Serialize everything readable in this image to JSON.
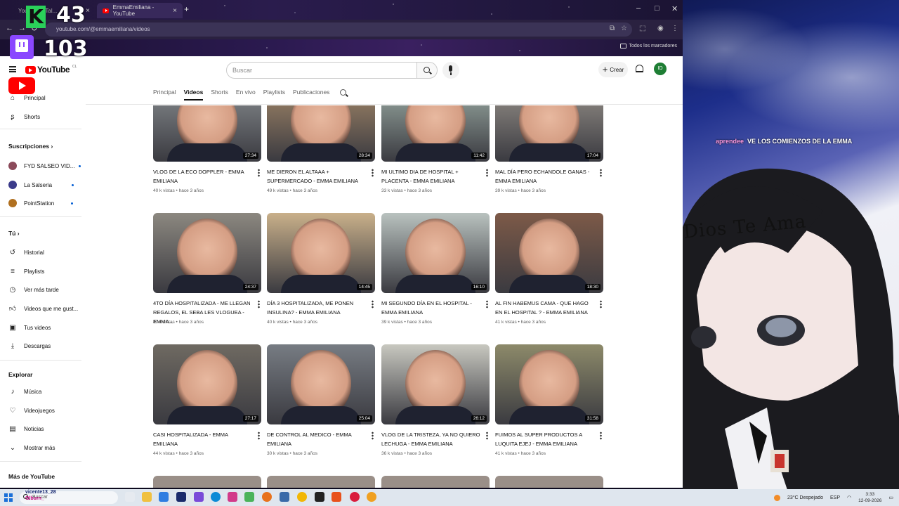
{
  "browser": {
    "tabs": [
      {
        "label": "YouTube - Tal..."
      },
      {
        "label": "EmmaEmiliana - YouTube"
      }
    ],
    "new_tab": "+",
    "window_controls": [
      "–",
      "□",
      "✕"
    ],
    "url": "youtube.com/@emmaemiliana/videos",
    "bookmarks_folder": "Todos los marcadores"
  },
  "overlays": {
    "k_badge": "K",
    "k_count": "43",
    "twitch_count": "103"
  },
  "youtube": {
    "logo": "YouTube",
    "logo_country": "CL",
    "search_placeholder": "Buscar",
    "create_label": "Crear",
    "avatar_initials": "ID",
    "sidebar": {
      "top": [
        {
          "label": "Principal",
          "icon": "home-icon"
        },
        {
          "label": "Shorts",
          "icon": "shorts-icon"
        }
      ],
      "subscriptions_heading": "Suscripciones",
      "subscriptions": [
        {
          "label": "FYD SALSEO VID...",
          "color": "#8b4a5a"
        },
        {
          "label": "La Salseria",
          "color": "#3b3b8a"
        },
        {
          "label": "PointStation",
          "color": "#b07020"
        }
      ],
      "you_heading": "Tú",
      "you_items": [
        {
          "label": "Historial",
          "icon": "history-icon"
        },
        {
          "label": "Playlists",
          "icon": "playlists-icon"
        },
        {
          "label": "Ver más tarde",
          "icon": "watch-later-icon"
        },
        {
          "label": "Videos que me gust...",
          "icon": "like-icon"
        },
        {
          "label": "Tus videos",
          "icon": "your-videos-icon"
        },
        {
          "label": "Descargas",
          "icon": "download-icon"
        }
      ],
      "explore_heading": "Explorar",
      "explore_items": [
        {
          "label": "Música",
          "icon": "music-icon"
        },
        {
          "label": "Videojuegos",
          "icon": "gaming-icon"
        },
        {
          "label": "Noticias",
          "icon": "news-icon"
        },
        {
          "label": "Mostrar más",
          "icon": "chevron-down-icon"
        }
      ],
      "more_heading": "Más de YouTube"
    },
    "channel_tabs": [
      "Principal",
      "Videos",
      "Shorts",
      "En vivo",
      "Playlists",
      "Publicaciones"
    ],
    "active_tab": "Videos",
    "videos": [
      {
        "title": "VLOG DE LA ECO DOPPLER - EMMA EMILIANA",
        "meta": "40 k vistas • hace 3 años",
        "duration": "27:34",
        "bg": "#8a8f92"
      },
      {
        "title": "ME DIERON EL ALTAAA + SUPERMERCADO - EMMA EMILIANA",
        "meta": "49 k vistas • hace 3 años",
        "duration": "28:34",
        "bg": "#a78a6a"
      },
      {
        "title": "MI ULTIMO DIA DE HOSPITAL + PLACENTA - EMMA EMILIANA",
        "meta": "33 k vistas • hace 3 años",
        "duration": "11:42",
        "bg": "#9fb0a8"
      },
      {
        "title": "MAL DÍA PERO ECHANDOLE GANAS - EMMA EMILIANA",
        "meta": "39 k vistas • hace 3 años",
        "duration": "17:04",
        "bg": "#9a948c"
      },
      {
        "title": "4TO DÍA HOSPITALIZADA - ME LLEGAN REGALOS, EL SEBA LES VLOGUEA - EMMA...",
        "meta": "47 k vistas • hace 3 años",
        "duration": "24:37",
        "bg": "#8c8880"
      },
      {
        "title": "DÍA 3 HOSPITALIZADA, ME PONEN INSULINA? - EMMA EMILIANA",
        "meta": "40 k vistas • hace 3 años",
        "duration": "14:45",
        "bg": "#c9b08a"
      },
      {
        "title": "MI SEGUNDO DÍA EN EL HOSPITAL - EMMA EMILIANA",
        "meta": "39 k vistas • hace 3 años",
        "duration": "16:10",
        "bg": "#b9c2bf"
      },
      {
        "title": "AL FIN HABEMUS CAMA - QUE HAGO EN EL HOSPITAL ? - EMMA EMILIANA",
        "meta": "41 k vistas • hace 3 años",
        "duration": "18:30",
        "bg": "#7d5a48"
      },
      {
        "title": "CASI HOSPITALIZADA - EMMA EMILIANA",
        "meta": "44 k vistas • hace 3 años",
        "duration": "27:17",
        "bg": "#6f6a62"
      },
      {
        "title": "DE CONTROL AL MEDICO - EMMA EMILIANA",
        "meta": "30 k vistas • hace 3 años",
        "duration": "25:04",
        "bg": "#777c83"
      },
      {
        "title": "VLOG DE LA TRISTEZA, YA NO QUIERO LECHUGA - EMMA EMILIANA",
        "meta": "36 k vistas • hace 3 años",
        "duration": "26:12",
        "bg": "#c8c8c0"
      },
      {
        "title": "FUIMOS AL SUPER PRODUCTOS A LUQUITA EJEJ - EMMA EMILIANA",
        "meta": "41 k vistas • hace 3 años",
        "duration": "31:58",
        "bg": "#8d8a6a"
      }
    ]
  },
  "stream": {
    "chat_user": "aprendee",
    "chat_message": "VE LOS COMIENZOS DE LA EMMA",
    "overlay_text": "Dios Te Ama"
  },
  "taskbar": {
    "search_placeholder": "Buscar",
    "viewer_user": "vicente13_28",
    "viewer_user2": "Olburn_",
    "weather": "23°C  Despejado",
    "lang": "ESP",
    "time": "3:33",
    "date": "12-09-2026"
  }
}
